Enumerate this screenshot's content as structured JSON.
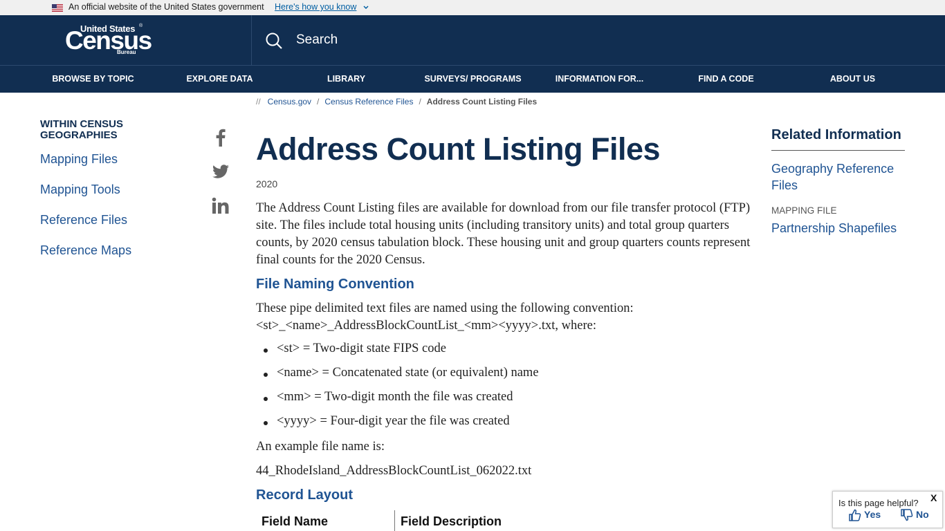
{
  "gov_banner": {
    "text": "An official website of the United States government",
    "link": "Here's how you know"
  },
  "logo": {
    "top": "United States",
    "main": "Census",
    "bottom": "Bureau",
    "reg": "®"
  },
  "search": {
    "label": "Search"
  },
  "nav": [
    "BROWSE BY TOPIC",
    "EXPLORE DATA",
    "LIBRARY",
    "SURVEYS/ PROGRAMS",
    "INFORMATION FOR...",
    "FIND A CODE",
    "ABOUT US"
  ],
  "breadcrumb": {
    "prefix": "//",
    "items": [
      "Census.gov",
      "Census Reference Files"
    ],
    "current": "Address Count Listing Files",
    "separator": "/"
  },
  "sidebar": {
    "heading": "WITHIN CENSUS GEOGRAPHIES",
    "links": [
      "Mapping Files",
      "Mapping Tools",
      "Reference Files",
      "Reference Maps"
    ]
  },
  "social": [
    "facebook-icon",
    "twitter-icon",
    "linkedin-icon"
  ],
  "main": {
    "title": "Address Count Listing Files",
    "year": "2020",
    "intro": "The Address Count Listing files are available for download from our file transfer protocol (FTP) site. The files include total housing units (including transitory units) and total group quarters counts, by 2020 census tabulation block. These housing unit and group quarters counts represent final counts for the 2020 Census.",
    "naming_heading": "File Naming Convention",
    "naming_line1": "These pipe delimited text files are named using the following convention:",
    "naming_line2": "<st>_<name>_AddressBlockCountList_<mm><yyyy>.txt,  where:",
    "bullets": [
      "<st> = Two-digit state FIPS code",
      "<name> = Concatenated state (or equivalent) name",
      "<mm> = Two-digit month the file was created",
      "<yyyy> = Four-digit year the file was created"
    ],
    "example_label": "An example file name is:",
    "example_file": "44_RhodeIsland_AddressBlockCountList_062022.txt",
    "record_heading": "Record Layout",
    "table_headers": [
      "Field Name",
      "Field Description"
    ]
  },
  "related": {
    "heading": "Related Information",
    "link1": "Geography Reference Files",
    "category": "MAPPING FILE",
    "link2": "Partnership Shapefiles"
  },
  "feedback": {
    "question": "Is this page helpful?",
    "yes": "Yes",
    "no": "No",
    "close": "X"
  },
  "colors": {
    "header_bg": "#112e51",
    "link": "#205493",
    "banner_bg": "#f0f0f0"
  }
}
